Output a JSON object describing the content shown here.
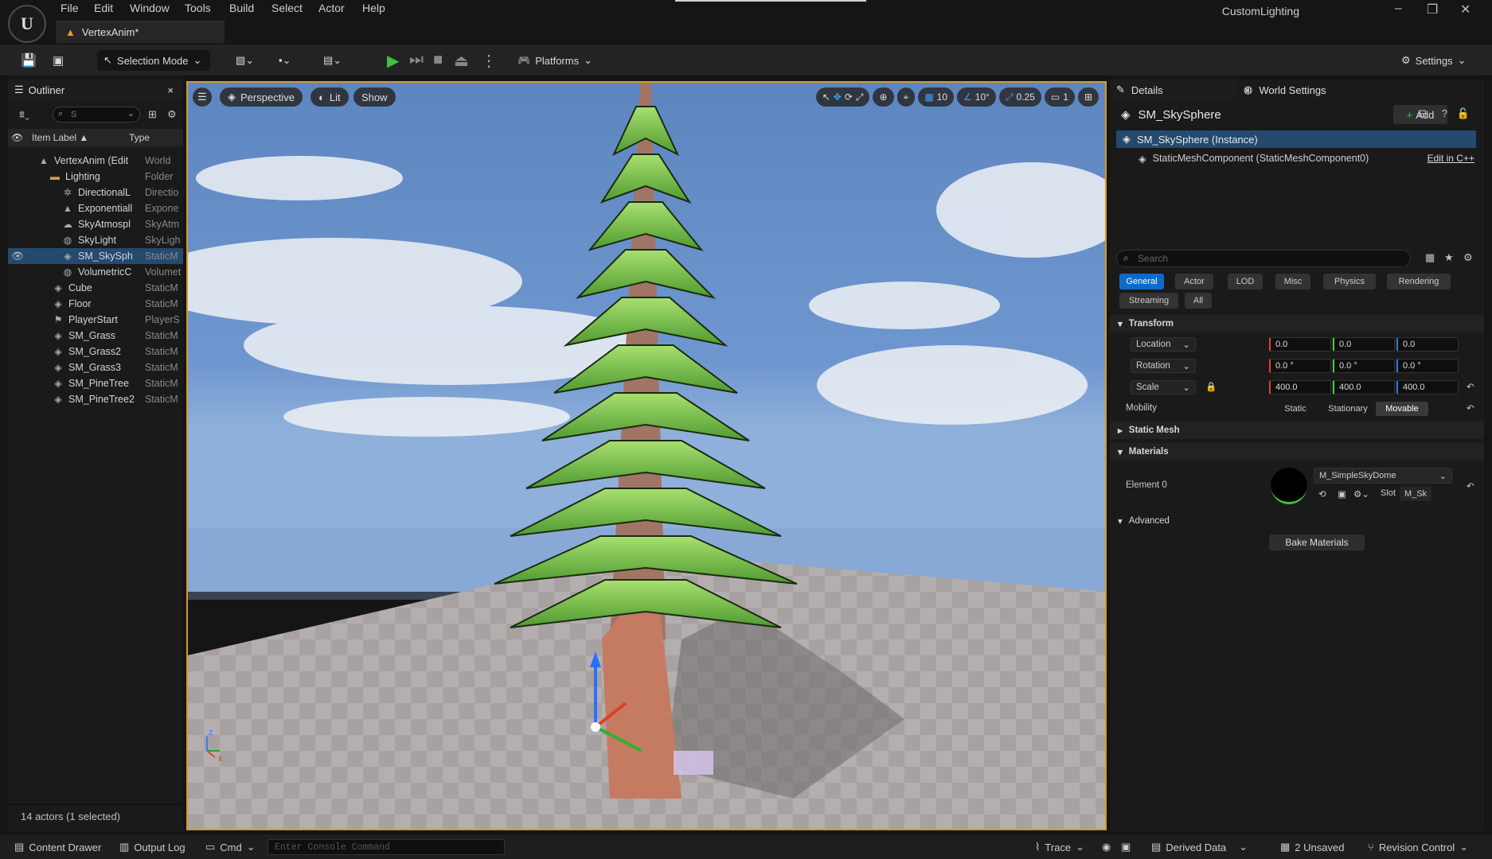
{
  "app": {
    "logo": "U",
    "project": "CustomLighting",
    "tab_title": "VertexAnim*"
  },
  "menu": [
    "File",
    "Edit",
    "Window",
    "Tools",
    "Build",
    "Select",
    "Actor",
    "Help"
  ],
  "toolbar": {
    "selection_mode": "Selection Mode",
    "platforms": "Platforms",
    "settings": "Settings"
  },
  "outliner": {
    "title": "Outliner",
    "search_value": "S",
    "col_label": "Item Label ▲",
    "col_type": "Type",
    "rows": [
      {
        "label": "VertexAnim (Edit",
        "type": "World"
      },
      {
        "label": "Lighting",
        "type": "Folder"
      },
      {
        "label": "DirectionalL",
        "type": "Directio"
      },
      {
        "label": "Exponentiall",
        "type": "Expone"
      },
      {
        "label": "SkyAtmospl",
        "type": "SkyAtm"
      },
      {
        "label": "SkyLight",
        "type": "SkyLigh"
      },
      {
        "label": "SM_SkySph",
        "type": "StaticM"
      },
      {
        "label": "VolumetricC",
        "type": "Volumet"
      },
      {
        "label": "Cube",
        "type": "StaticM"
      },
      {
        "label": "Floor",
        "type": "StaticM"
      },
      {
        "label": "PlayerStart",
        "type": "PlayerS"
      },
      {
        "label": "SM_Grass",
        "type": "StaticM"
      },
      {
        "label": "SM_Grass2",
        "type": "StaticM"
      },
      {
        "label": "SM_Grass3",
        "type": "StaticM"
      },
      {
        "label": "SM_PineTree",
        "type": "StaticM"
      },
      {
        "label": "SM_PineTree2",
        "type": "StaticM"
      }
    ],
    "footer": "14 actors (1 selected)"
  },
  "viewport": {
    "perspective": "Perspective",
    "lit": "Lit",
    "show": "Show",
    "grid": "10",
    "angle": "10°",
    "scale": "0.25",
    "camera": "1"
  },
  "details": {
    "tab_details": "Details",
    "tab_world": "World Settings",
    "actor": "SM_SkySphere",
    "add": "Add",
    "instance": "SM_SkySphere (Instance)",
    "component": "StaticMeshComponent (StaticMeshComponent0)",
    "edit_cpp": "Edit in C++",
    "search_placeholder": "Search",
    "filters": [
      "General",
      "Actor",
      "LOD",
      "Misc",
      "Physics",
      "Rendering",
      "Streaming",
      "All"
    ],
    "transform": "Transform",
    "location": "Location",
    "loc": [
      "0.0",
      "0.0",
      "0.0"
    ],
    "rotation": "Rotation",
    "rot": [
      "0.0 °",
      "0.0 °",
      "0.0 °"
    ],
    "scale": "Scale",
    "scl": [
      "400.0",
      "400.0",
      "400.0"
    ],
    "mobility": "Mobility",
    "mob": [
      "Static",
      "Stationary",
      "Movable"
    ],
    "static_mesh": "Static Mesh",
    "materials": "Materials",
    "element": "Element 0",
    "material": "M_SimpleSkyDome",
    "slot": "Slot",
    "slot_value": "M_Sk",
    "advanced": "Advanced",
    "bake": "Bake Materials"
  },
  "status": {
    "content_drawer": "Content Drawer",
    "output_log": "Output Log",
    "cmd": "Cmd",
    "console_placeholder": "Enter Console Command",
    "trace": "Trace",
    "derived": "Derived Data",
    "unsaved": "2 Unsaved",
    "revision": "Revision Control"
  }
}
